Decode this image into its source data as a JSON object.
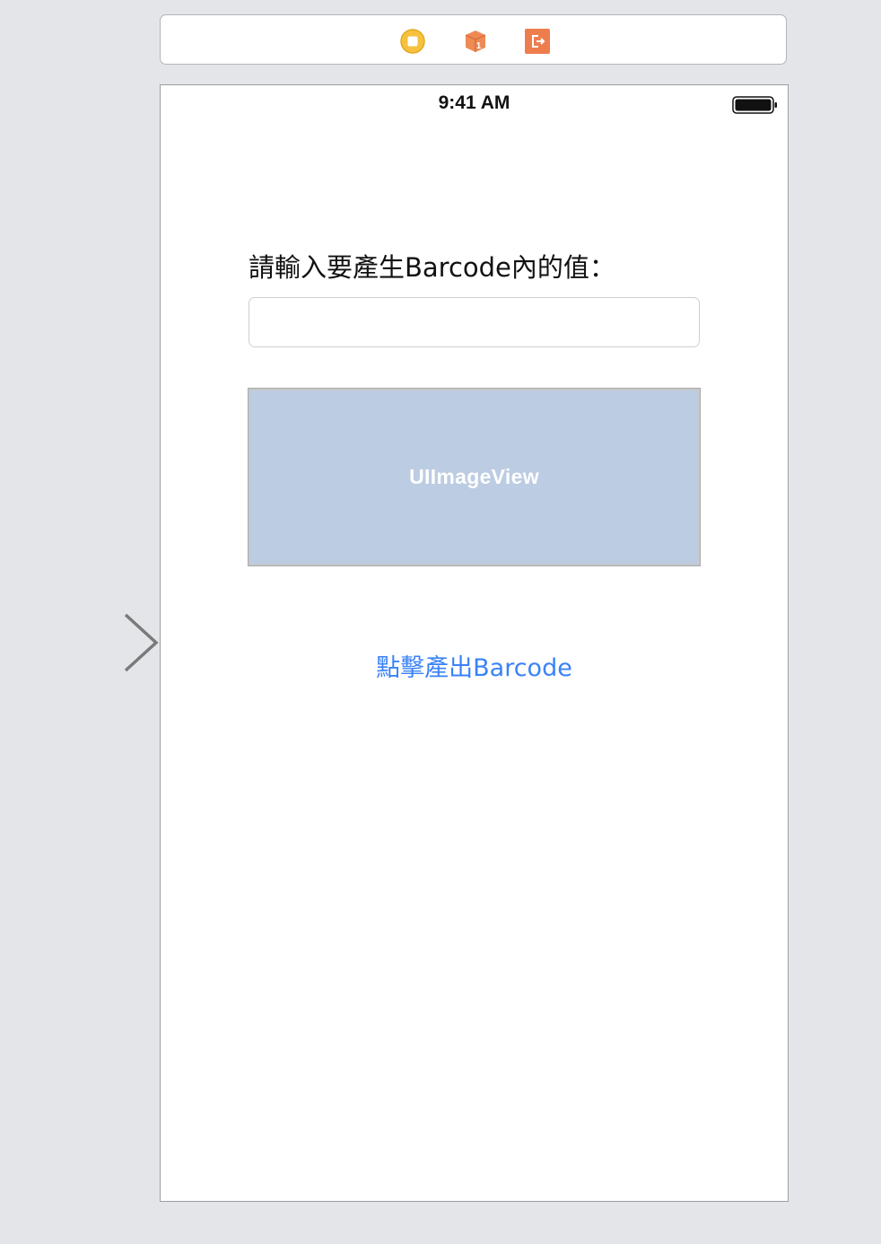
{
  "scene_dock": {
    "icons": [
      "view-controller-icon",
      "first-responder-icon",
      "exit-icon"
    ],
    "first_responder_badge": "1"
  },
  "status_bar": {
    "time": "9:41 AM"
  },
  "form": {
    "prompt_label": "請輸入要產生Barcode內的值：",
    "input_value": ""
  },
  "image_view": {
    "label": "UIImageView"
  },
  "generate_button": {
    "label": "點擊產出Barcode"
  },
  "colors": {
    "canvas_background": "#e4e5e8",
    "image_view_fill": "#bccce2",
    "button_tint": "#3a82f7",
    "view_controller_icon": "#f6c23e",
    "first_responder_icon": "#ee8a54",
    "exit_icon": "#ee7d4e"
  }
}
